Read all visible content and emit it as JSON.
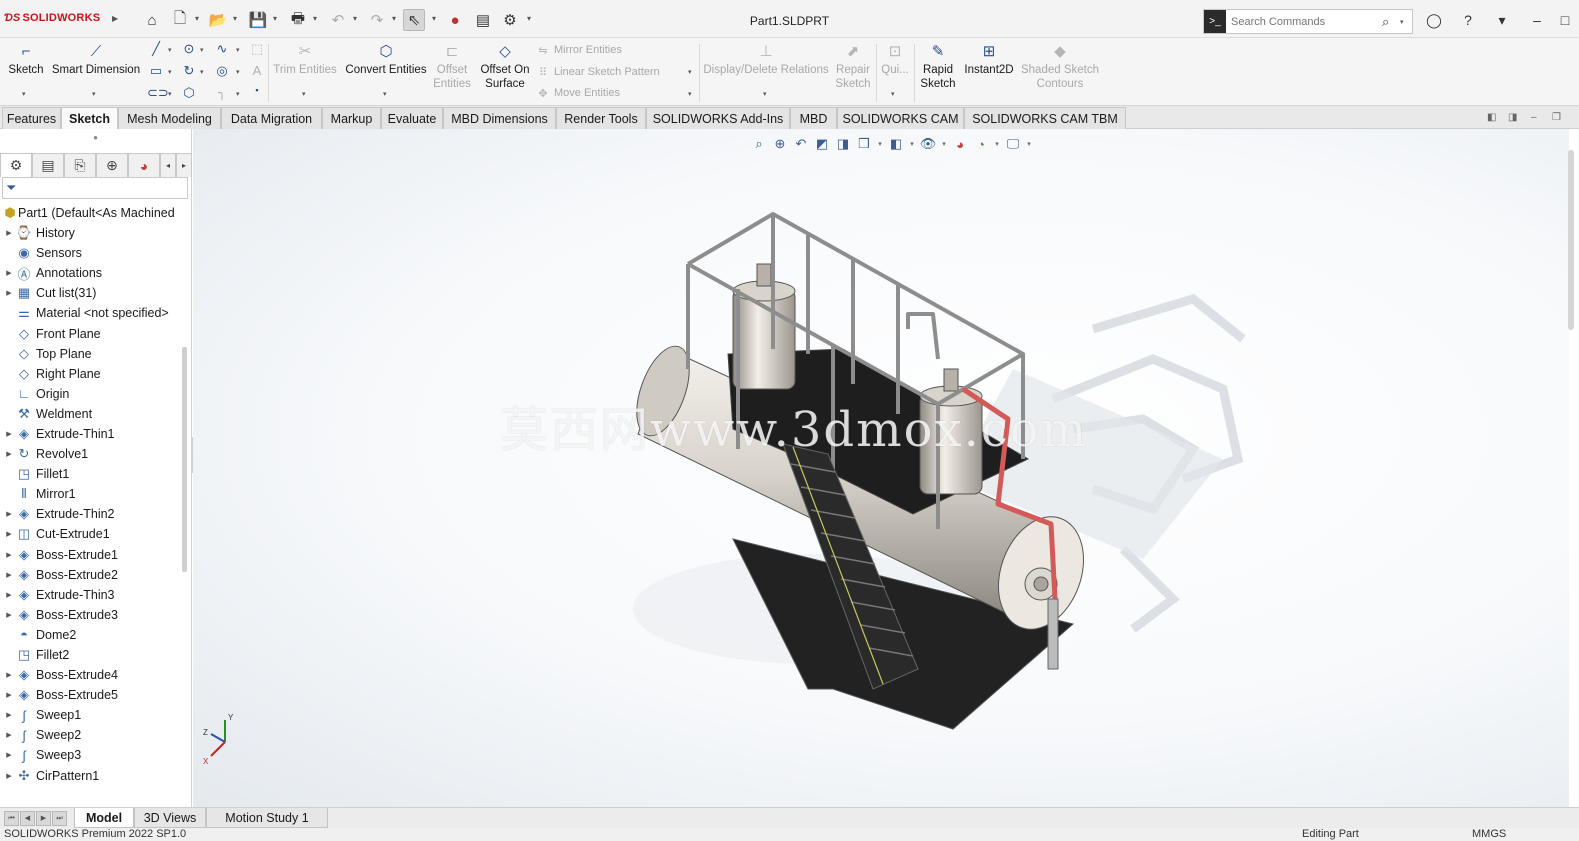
{
  "app": {
    "brand": "SOLIDWORKS",
    "document_title": "Part1.SLDPRT"
  },
  "search": {
    "placeholder": "Search Commands"
  },
  "ribbon": {
    "sketch": "Sketch",
    "smart_dimension": "Smart Dimension",
    "trim_entities": "Trim Entities",
    "convert_entities": "Convert Entities",
    "offset_entities": "Offset Entities",
    "offset_on_surface": "Offset On Surface",
    "mirror_entities": "Mirror Entities",
    "linear_sketch_pattern": "Linear Sketch Pattern",
    "move_entities": "Move Entities",
    "display_delete_relations": "Display/Delete Relations",
    "repair_sketch": "Repair Sketch",
    "quick_snaps": "Qui...",
    "rapid_sketch": "Rapid Sketch",
    "instant2d": "Instant2D",
    "shaded_sketch_contours": "Shaded Sketch Contours"
  },
  "tabs": [
    "Features",
    "Sketch",
    "Mesh Modeling",
    "Data Migration",
    "Markup",
    "Evaluate",
    "MBD Dimensions",
    "Render Tools",
    "SOLIDWORKS Add-Ins",
    "MBD",
    "SOLIDWORKS CAM",
    "SOLIDWORKS CAM TBM"
  ],
  "active_tab": "Sketch",
  "tree": {
    "root": "Part1 (Default<As Machined",
    "items": [
      {
        "label": "History",
        "icon": "history-icon",
        "expandable": true
      },
      {
        "label": "Sensors",
        "icon": "sensors-icon",
        "expandable": false
      },
      {
        "label": "Annotations",
        "icon": "annotations-icon",
        "expandable": true
      },
      {
        "label": "Cut list(31)",
        "icon": "cut-list-icon",
        "expandable": true
      },
      {
        "label": "Material <not specified>",
        "icon": "material-icon",
        "expandable": false
      },
      {
        "label": "Front Plane",
        "icon": "plane-icon",
        "expandable": false
      },
      {
        "label": "Top Plane",
        "icon": "plane-icon",
        "expandable": false
      },
      {
        "label": "Right Plane",
        "icon": "plane-icon",
        "expandable": false
      },
      {
        "label": "Origin",
        "icon": "origin-icon",
        "expandable": false
      },
      {
        "label": "Weldment",
        "icon": "weldment-icon",
        "expandable": false
      },
      {
        "label": "Extrude-Thin1",
        "icon": "extrude-icon",
        "expandable": true
      },
      {
        "label": "Revolve1",
        "icon": "revolve-icon",
        "expandable": true
      },
      {
        "label": "Fillet1",
        "icon": "fillet-icon",
        "expandable": false
      },
      {
        "label": "Mirror1",
        "icon": "mirror-icon",
        "expandable": false
      },
      {
        "label": "Extrude-Thin2",
        "icon": "extrude-icon",
        "expandable": true
      },
      {
        "label": "Cut-Extrude1",
        "icon": "cut-extrude-icon",
        "expandable": true
      },
      {
        "label": "Boss-Extrude1",
        "icon": "extrude-icon",
        "expandable": true
      },
      {
        "label": "Boss-Extrude2",
        "icon": "extrude-icon",
        "expandable": true
      },
      {
        "label": "Extrude-Thin3",
        "icon": "extrude-icon",
        "expandable": true
      },
      {
        "label": "Boss-Extrude3",
        "icon": "extrude-icon",
        "expandable": true
      },
      {
        "label": "Dome2",
        "icon": "dome-icon",
        "expandable": false
      },
      {
        "label": "Fillet2",
        "icon": "fillet-icon",
        "expandable": false
      },
      {
        "label": "Boss-Extrude4",
        "icon": "extrude-icon",
        "expandable": true
      },
      {
        "label": "Boss-Extrude5",
        "icon": "extrude-icon",
        "expandable": true
      },
      {
        "label": "Sweep1",
        "icon": "sweep-icon",
        "expandable": true
      },
      {
        "label": "Sweep2",
        "icon": "sweep-icon",
        "expandable": true
      },
      {
        "label": "Sweep3",
        "icon": "sweep-icon",
        "expandable": true
      },
      {
        "label": "CirPattern1",
        "icon": "circular-pattern-icon",
        "expandable": true
      }
    ]
  },
  "watermark": "莫西网www.3dmox.com",
  "triad": {
    "y": "Y",
    "z": "Z",
    "x": "X"
  },
  "bottom_tabs": [
    "Model",
    "3D Views",
    "Motion Study 1"
  ],
  "active_bottom_tab": "Model",
  "status": {
    "left": "SOLIDWORKS Premium 2022 SP1.0",
    "mode": "Editing Part",
    "units": "MMGS"
  },
  "colors": {
    "brand_red": "#d0111b",
    "accent_blue": "#2a4e8c",
    "pipe_red": "#d45a5a"
  }
}
